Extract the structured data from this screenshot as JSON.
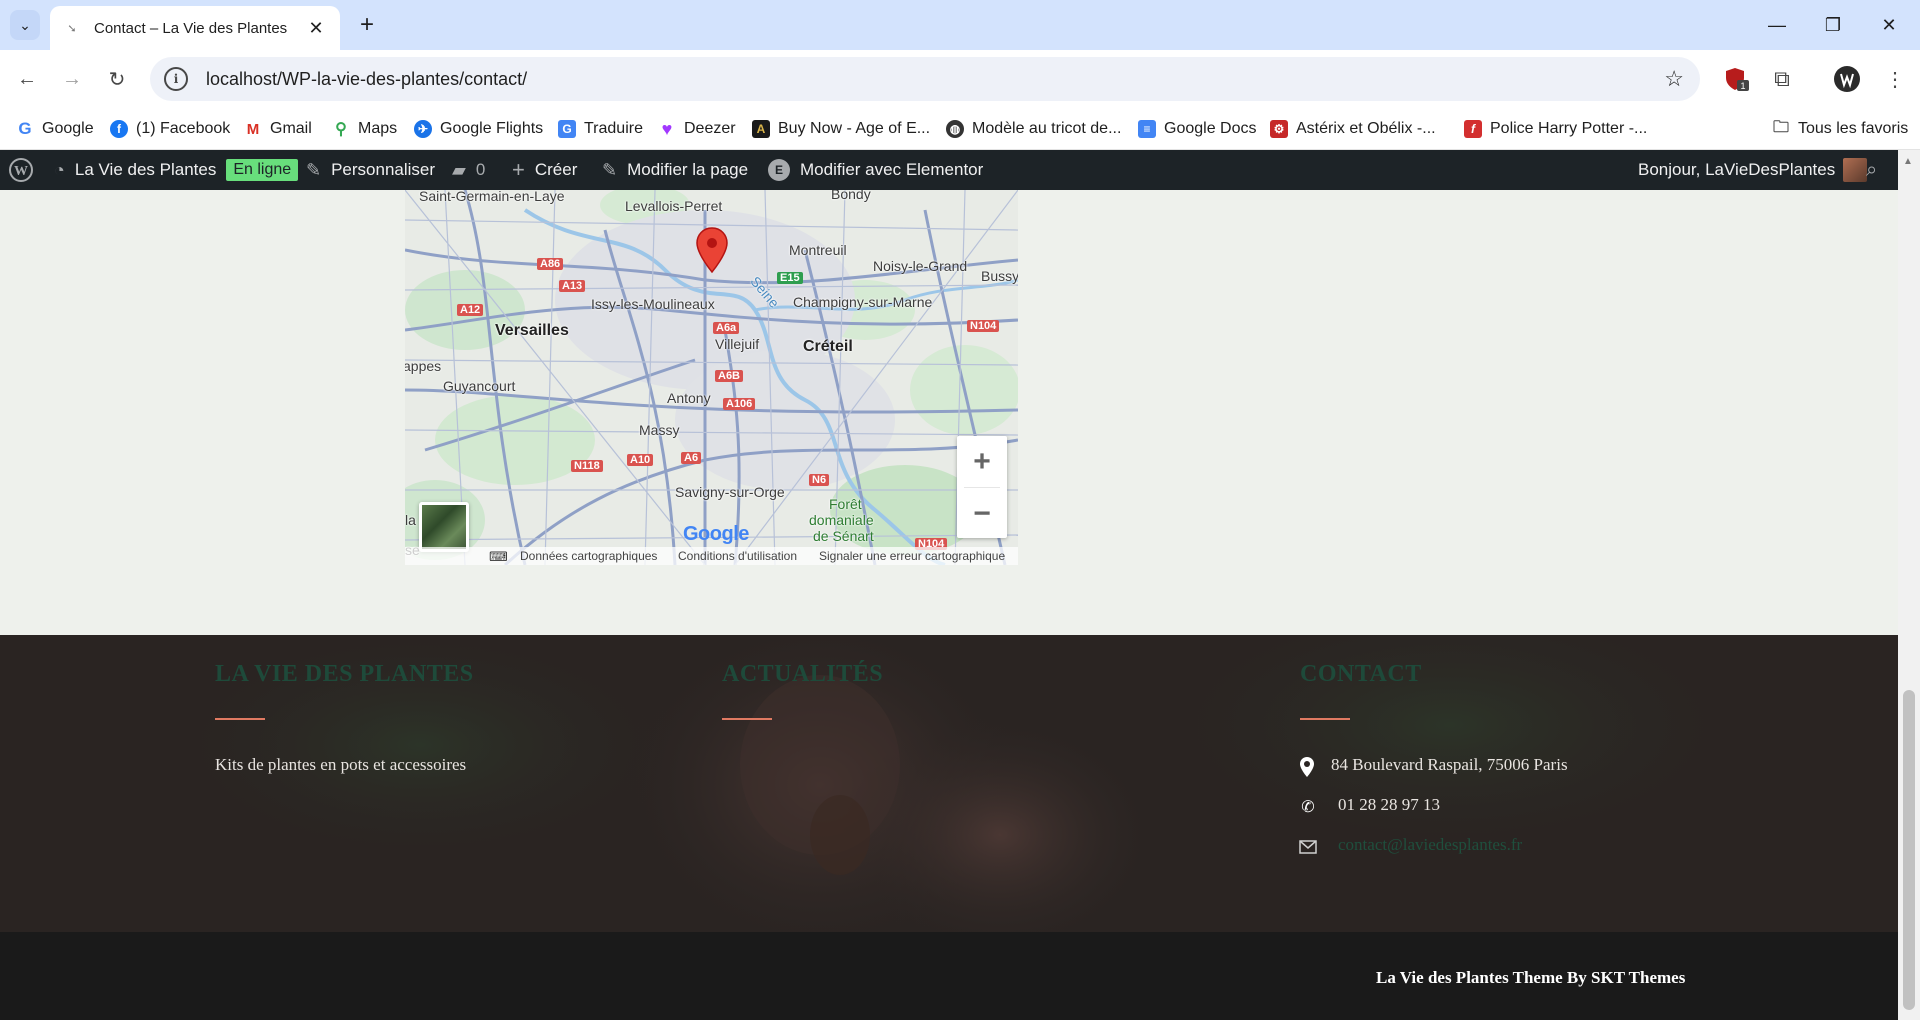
{
  "browser": {
    "tab_title": "Contact – La Vie des Plantes",
    "url": "localhost/WP-la-vie-des-plantes/contact/",
    "extension_badge": "1",
    "bookmarks": [
      {
        "label": "Google",
        "icon": "google-icon"
      },
      {
        "label": "(1) Facebook",
        "icon": "facebook-icon"
      },
      {
        "label": "Gmail",
        "icon": "gmail-icon"
      },
      {
        "label": "Maps",
        "icon": "maps-icon"
      },
      {
        "label": "Google Flights",
        "icon": "flights-icon"
      },
      {
        "label": "Traduire",
        "icon": "translate-icon"
      },
      {
        "label": "Deezer",
        "icon": "deezer-icon"
      },
      {
        "label": "Buy Now - Age of E...",
        "icon": "age-of-empires-icon"
      },
      {
        "label": "Modèle au tricot de...",
        "icon": "knitting-icon"
      },
      {
        "label": "Google Docs",
        "icon": "docs-icon"
      },
      {
        "label": "Astérix et Obélix -...",
        "icon": "asterix-icon"
      },
      {
        "label": "Police Harry Potter -...",
        "icon": "font-icon"
      }
    ],
    "all_bookmarks": "Tous les favoris"
  },
  "adminbar": {
    "site_name": "La Vie des Plantes",
    "status": "En ligne",
    "customize": "Personnaliser",
    "comments": "0",
    "create": "Créer",
    "edit_page": "Modifier la page",
    "edit_elementor": "Modifier avec Elementor",
    "greeting": "Bonjour, LaVieDesPlantes"
  },
  "map": {
    "labels": {
      "saint_germain": "Saint-Germain-en-Laye",
      "levallois": "Levallois-Perret",
      "bondy": "Bondy",
      "montreuil": "Montreuil",
      "noisy": "Noisy-le-Grand",
      "bussy": "Bussy",
      "issy": "Issy-les-Moulineaux",
      "seine": "Seine",
      "champigny": "Champigny-sur-Marne",
      "versailles": "Versailles",
      "villejuif": "Villejuif",
      "creteil": "Créteil",
      "appes": "appes",
      "guyancourt": "Guyancourt",
      "antony": "Antony",
      "massy": "Massy",
      "savigny": "Savigny-sur-Orge",
      "foret": "Forêt",
      "domaniale": "domaniale",
      "senart": "de Sénart",
      "la": "la",
      "se": "se"
    },
    "roads": {
      "a86": "A86",
      "a13": "A13",
      "a12": "A12",
      "e15": "E15",
      "n104a": "N104",
      "a6a": "A6a",
      "a6b": "A6B",
      "a106": "A106",
      "n118": "N118",
      "a10": "A10",
      "a6": "A6",
      "n6": "N6",
      "n104b": "N104"
    },
    "zoom_in": "+",
    "zoom_out": "−",
    "logo": "Google",
    "attribution": {
      "data": "Données cartographiques",
      "terms": "Conditions d'utilisation",
      "report": "Signaler une erreur cartographique"
    }
  },
  "footer": {
    "col1": {
      "title": "LA VIE DES PLANTES",
      "text": "Kits de plantes en pots et accessoires"
    },
    "col2": {
      "title": "ACTUALITÉS"
    },
    "col3": {
      "title": "CONTACT",
      "address": "84 Boulevard Raspail, 75006 Paris",
      "phone": "01 28 28 97 13",
      "email": "contact@laviedesplantes.fr"
    },
    "copyright": "La Vie des Plantes Theme By SKT Themes"
  }
}
